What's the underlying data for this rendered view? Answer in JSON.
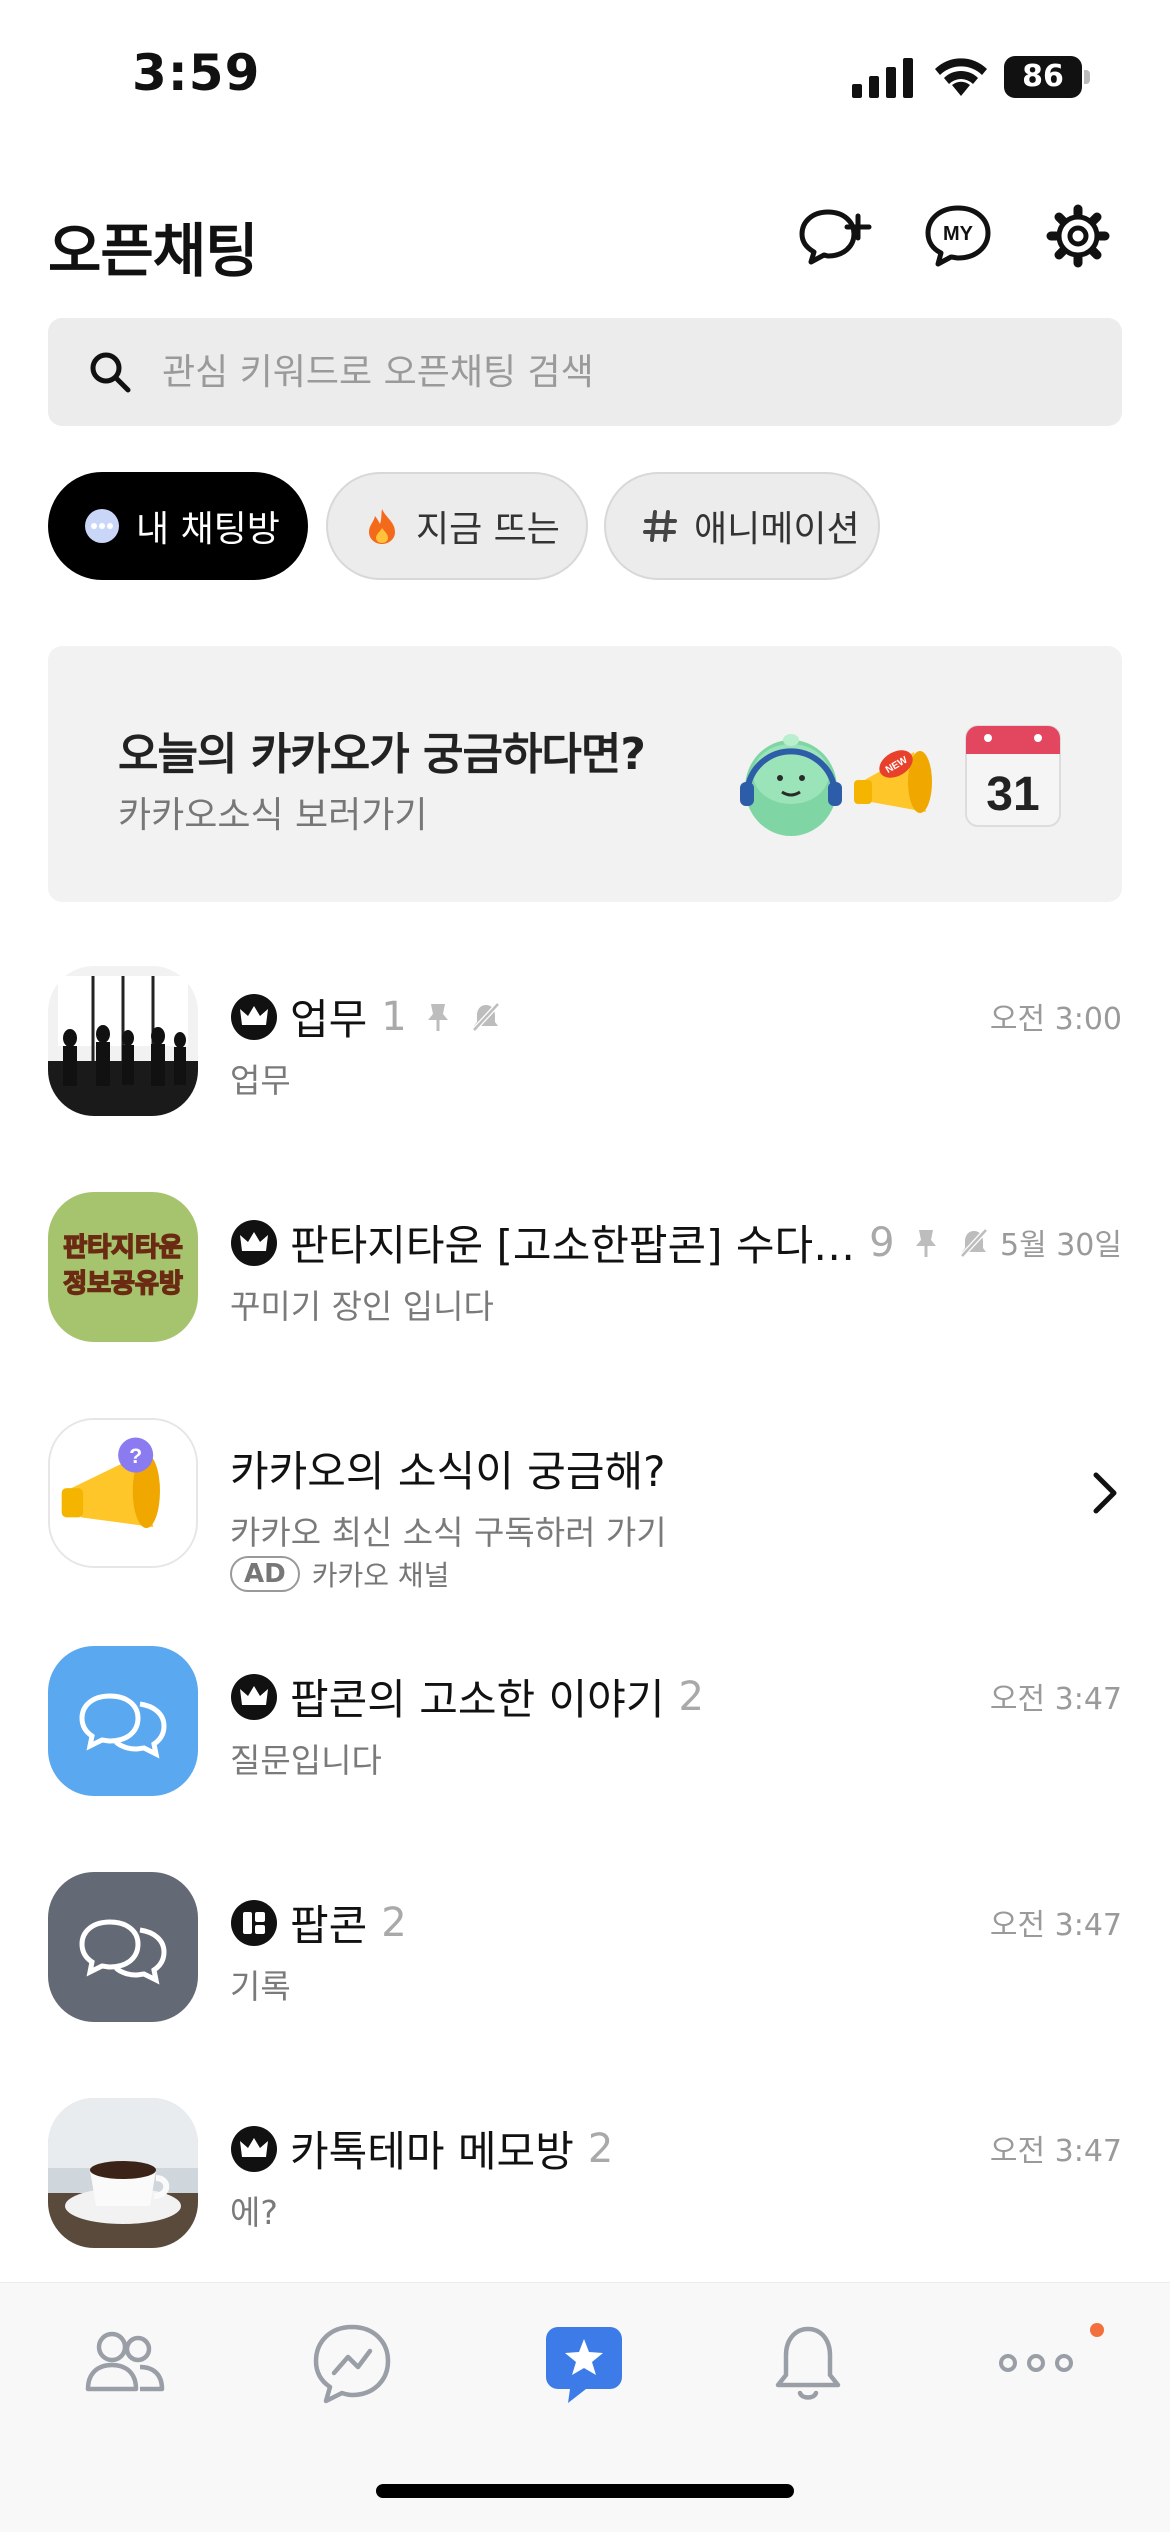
{
  "status_bar": {
    "time": "3:59",
    "battery": "86"
  },
  "header": {
    "title": "오픈채팅",
    "icons": [
      "new-chat-icon",
      "my-profile-icon",
      "gear-icon"
    ],
    "my_label": "MY"
  },
  "search": {
    "placeholder": "관심 키워드로 오픈채팅 검색"
  },
  "chips": [
    {
      "label": "내 채팅방",
      "icon": "chat-bubble-icon",
      "active": true
    },
    {
      "label": "지금 뜨는",
      "icon": "fire-icon",
      "active": false
    },
    {
      "label": "애니메이션",
      "icon": "hashtag-icon",
      "active": false
    }
  ],
  "banner": {
    "title": "오늘의 카카오가 궁금하다면?",
    "subtitle": "카카오소식 보러가기",
    "calendar_day": "31",
    "new_label": "NEW"
  },
  "chats": [
    {
      "title": "업무",
      "count": "1",
      "subtitle": "업무",
      "time": "오전 3:00",
      "badge": "crown",
      "pinned": true,
      "muted": true
    },
    {
      "title": "판타지타운 [고소한팝콘] 수다…",
      "count": "9",
      "subtitle": "꾸미기 장인 입니다",
      "time": "5월 30일",
      "badge": "crown",
      "pinned": true,
      "muted": true,
      "avatar_text": [
        "판타지타운",
        "정보공유방"
      ]
    },
    {
      "title": "카카오의 소식이 궁금해?",
      "subtitle": "카카오 최신 소식 구독하러 가기",
      "ad_label": "AD",
      "ad_source": "카카오 채널",
      "is_ad": true
    },
    {
      "title": "팝콘의 고소한 이야기",
      "count": "2",
      "subtitle": "질문입니다",
      "time": "오전 3:47",
      "badge": "crown"
    },
    {
      "title": "팝콘",
      "count": "2",
      "subtitle": "기록",
      "time": "오전 3:47",
      "badge": "manager"
    },
    {
      "title": "카톡테마 메모방",
      "count": "2",
      "subtitle": "에?",
      "time": "오전 3:47",
      "badge": "crown"
    }
  ],
  "tab_bar": {
    "tabs": [
      "friends-icon",
      "chats-icon",
      "open-chat-icon",
      "notification-bell-icon",
      "more-icon"
    ],
    "active": "open-chat-icon"
  },
  "colors": {
    "active_tab": "#3d7ce8",
    "notification_dot": "#f36f3c",
    "chip_active_bg": "#000000"
  }
}
